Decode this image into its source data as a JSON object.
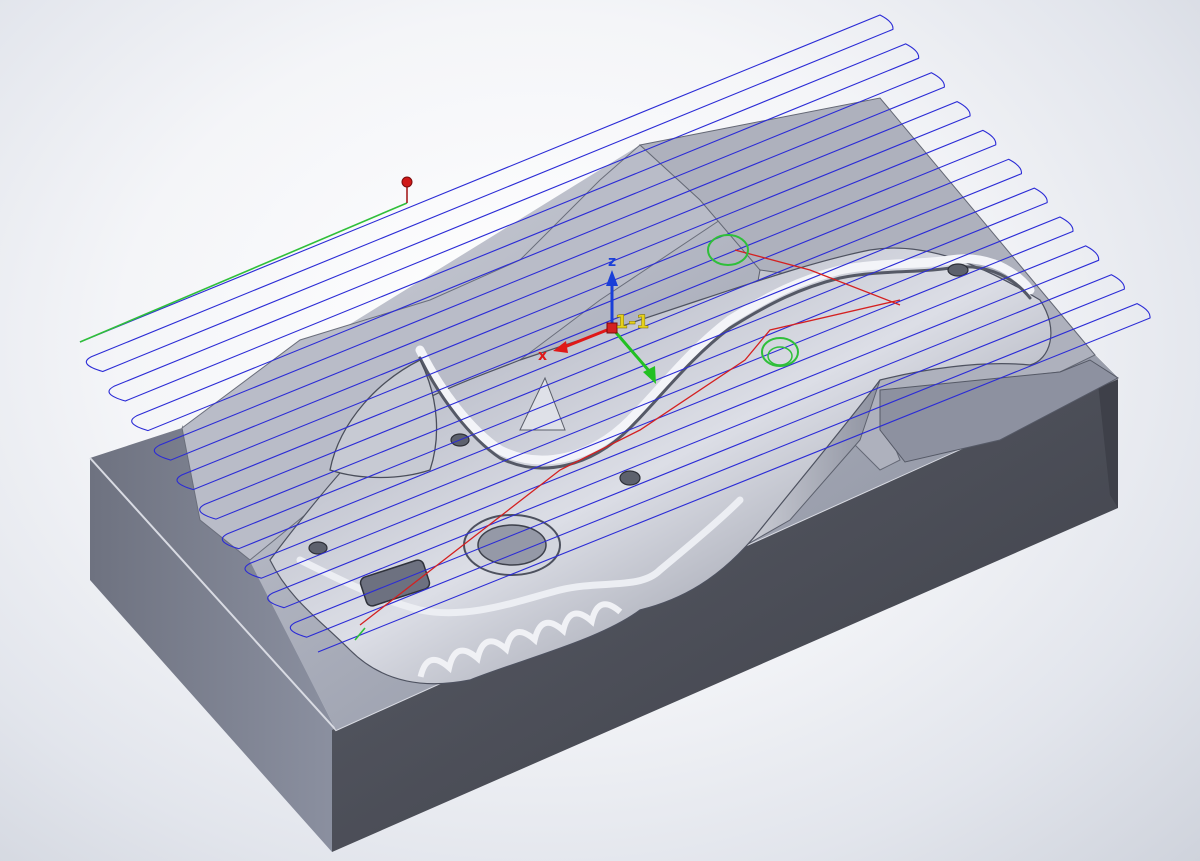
{
  "view": {
    "type": "CAM toolpath 3D viewport",
    "coordinate_system_label": "1-1",
    "axis_labels": {
      "x": "x",
      "y": "y",
      "z": "z"
    },
    "colors": {
      "toolpath": "#2b2bd6",
      "lead_in": "#2fbf3a",
      "rapid": "#d42020",
      "axis_x": "#e01818",
      "axis_y": "#22c022",
      "axis_z": "#1a3fd8",
      "label": "#e6d11a",
      "stock_dark": "#4a4c55",
      "stock_mid": "#7a7f8c",
      "stock_light": "#c9ccd6"
    }
  }
}
